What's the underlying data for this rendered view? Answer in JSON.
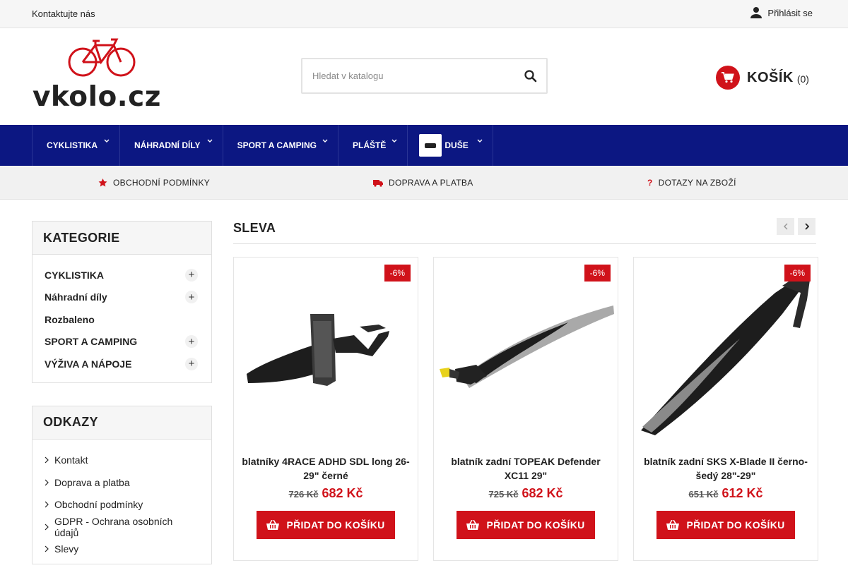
{
  "topbar": {
    "contact": "Kontaktujte nás",
    "login": "Přihlásit se"
  },
  "logo": {
    "text": "vkolo.cz"
  },
  "search": {
    "placeholder": "Hledat v katalogu"
  },
  "cart": {
    "label": "KOŠÍK",
    "count": "(0)"
  },
  "nav": {
    "items": [
      {
        "label": "CYKLISTIKA"
      },
      {
        "label": "NÁHRADNÍ DÍLY"
      },
      {
        "label": "SPORT A CAMPING"
      },
      {
        "label": "PLÁŠTĚ"
      },
      {
        "label": "DUŠE"
      }
    ]
  },
  "infobar": {
    "terms": "OBCHODNÍ PODMÍNKY",
    "shipping": "DOPRAVA A PLATBA",
    "questions": "DOTAZY NA ZBOŽÍ"
  },
  "sidebar": {
    "categories_title": "KATEGORIE",
    "categories": [
      {
        "label": "CYKLISTIKA"
      },
      {
        "label": "Náhradní díly"
      },
      {
        "label": "Rozbaleno"
      },
      {
        "label": "SPORT A CAMPING"
      },
      {
        "label": "VÝŽIVA A NÁPOJE"
      }
    ],
    "links_title": "ODKAZY",
    "links": [
      {
        "label": "Kontakt"
      },
      {
        "label": "Doprava a platba"
      },
      {
        "label": "Obchodní podmínky"
      },
      {
        "label": "GDPR - Ochrana osobních údajů"
      },
      {
        "label": "Slevy"
      }
    ]
  },
  "main": {
    "section_title": "SLEVA",
    "products": [
      {
        "name": "blatníky 4RACE ADHD SDL long 26-29\" černé",
        "discount": "-6%",
        "old_price": "726 Kč",
        "price": "682 Kč",
        "button": "PŘIDAT DO KOŠÍKU"
      },
      {
        "name": "blatník zadní TOPEAK Defender XC11 29\"",
        "discount": "-6%",
        "old_price": "725 Kč",
        "price": "682 Kč",
        "button": "PŘIDAT DO KOŠÍKU"
      },
      {
        "name": "blatník zadní SKS X-Blade II černo-šedý 28\"-29\"",
        "discount": "-6%",
        "old_price": "651 Kč",
        "price": "612 Kč",
        "button": "PŘIDAT DO KOŠÍKU"
      }
    ]
  },
  "colors": {
    "accent": "#d0121a",
    "nav": "#0c1782"
  }
}
